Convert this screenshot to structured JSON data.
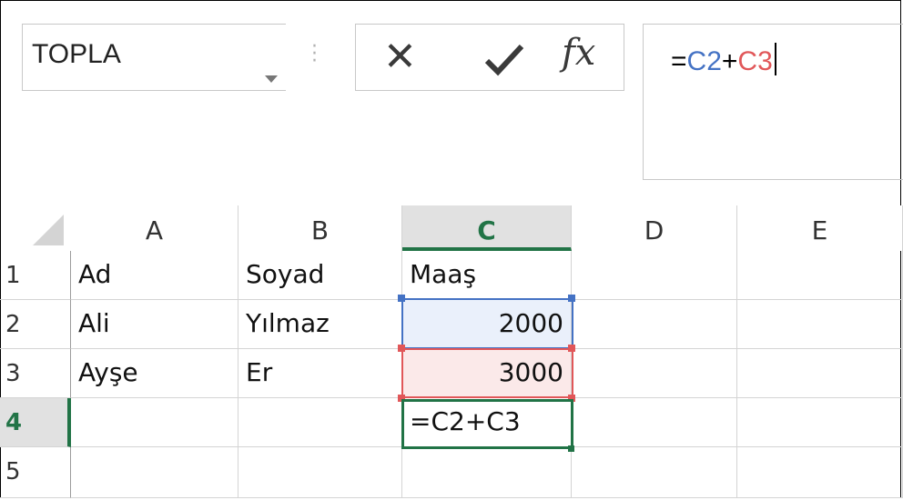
{
  "name_box": {
    "value": "TOPLA"
  },
  "formula_bar": {
    "prefix": "=",
    "ref1": "C2",
    "op": "+",
    "ref2": "C3"
  },
  "icons": {
    "cancel": "close-icon",
    "enter": "check-icon",
    "function": "fx-icon",
    "fx_label": "fx"
  },
  "columns": [
    "A",
    "B",
    "C",
    "D",
    "E"
  ],
  "rows": [
    {
      "num": "1",
      "cells": [
        "Ad",
        "Soyad",
        "Maaş",
        "",
        ""
      ]
    },
    {
      "num": "2",
      "cells": [
        "Ali",
        "Yılmaz",
        "2000",
        "",
        ""
      ]
    },
    {
      "num": "3",
      "cells": [
        "Ayşe",
        "Er",
        "3000",
        "",
        ""
      ]
    },
    {
      "num": "4",
      "cells": [
        "",
        "",
        "=C2+C3",
        "",
        ""
      ]
    },
    {
      "num": "5",
      "cells": [
        "",
        "",
        "",
        "",
        ""
      ]
    }
  ],
  "colors": {
    "ref1": "#4472c4",
    "ref2": "#e15759",
    "active": "#217346"
  }
}
